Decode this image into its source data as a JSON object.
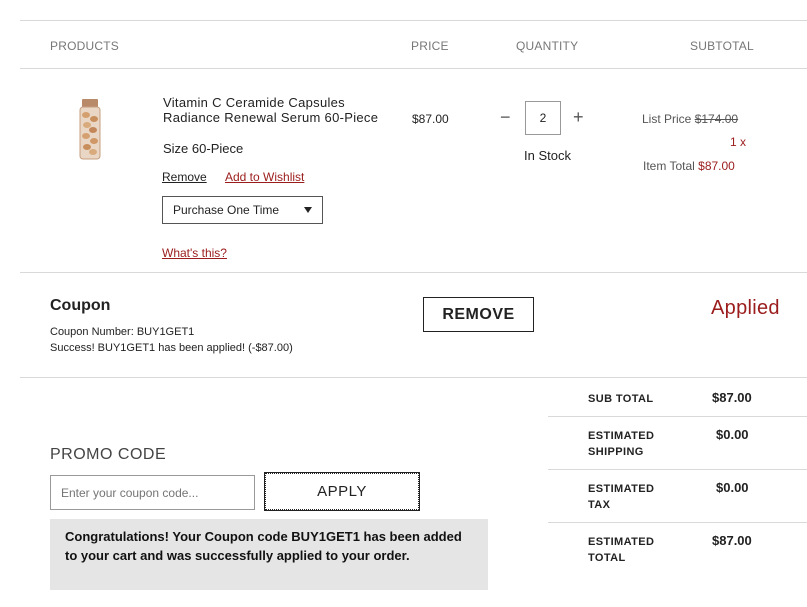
{
  "columns": {
    "products": "PRODUCTS",
    "price": "PRICE",
    "quantity": "QUANTITY",
    "subtotal": "SUBTOTAL"
  },
  "item": {
    "name": "Vitamin C Ceramide Capsules Radiance Renewal Serum 60-Piece",
    "size": "Size 60-Piece",
    "remove_label": "Remove",
    "wishlist_label": "Add to Wishlist",
    "purchase_option": "Purchase One Time",
    "whats_this": "What's this?",
    "price": "$87.00",
    "quantity": "2",
    "stock": "In Stock",
    "list_price_label": "List Price",
    "list_price": "$174.00",
    "multiplier": "1 x",
    "item_total_label": "Item Total",
    "item_total": "$87.00"
  },
  "coupon": {
    "heading": "Coupon",
    "number_line": "Coupon Number: BUY1GET1",
    "success_line": "Success! BUY1GET1 has been applied! (-$87.00)",
    "remove_label": "REMOVE",
    "status": "Applied"
  },
  "promo": {
    "heading": "PROMO CODE",
    "placeholder": "Enter your coupon code...",
    "apply_label": "APPLY",
    "message": "Congratulations! Your Coupon code BUY1GET1 has been added to your cart and was successfully applied to your order."
  },
  "summary": {
    "subtotal_label": "SUB TOTAL",
    "subtotal": "$87.00",
    "shipping_label_1": "ESTIMATED",
    "shipping_label_2": "SHIPPING",
    "shipping": "$0.00",
    "tax_label_1": "ESTIMATED",
    "tax_label_2": "TAX",
    "tax": "$0.00",
    "total_label_1": "ESTIMATED",
    "total_label_2": "TOTAL",
    "total": "$87.00"
  },
  "colors": {
    "accent_red": "#9b1c1c",
    "notice_bg": "#e5e5e5"
  }
}
